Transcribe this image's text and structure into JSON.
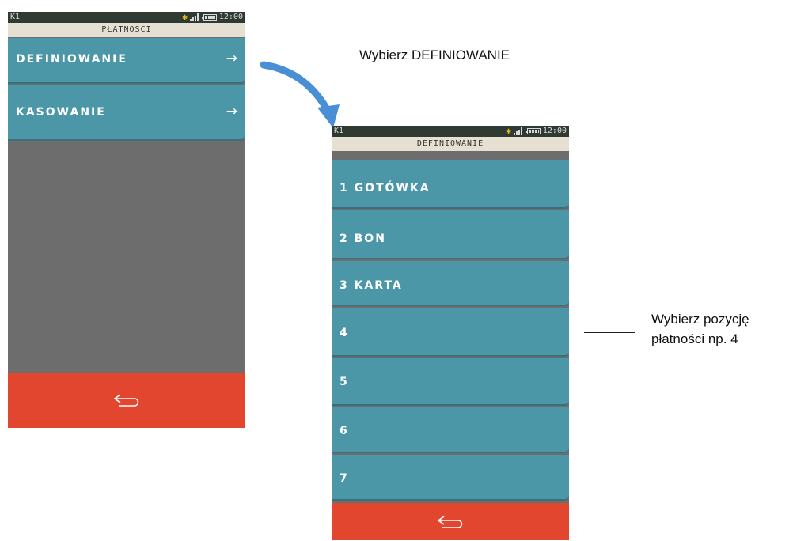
{
  "screen1": {
    "status": {
      "carrier": "K1",
      "time": "12:00"
    },
    "title": "PŁATNOŚCI",
    "items": [
      {
        "label": "DEFINIOWANIE",
        "arrow": "→"
      },
      {
        "label": "KASOWANIE",
        "arrow": "→"
      }
    ],
    "back_icon": "back-arrow-icon"
  },
  "screen2": {
    "status": {
      "carrier": "K1",
      "time": "12:00"
    },
    "title": "DEFINIOWANIE",
    "items": [
      {
        "label": "1  GOTÓWKA"
      },
      {
        "label": "2  BON"
      },
      {
        "label": "3  KARTA"
      },
      {
        "label": "4"
      },
      {
        "label": "5"
      },
      {
        "label": "6"
      },
      {
        "label": "7"
      }
    ],
    "back_icon": "back-arrow-icon"
  },
  "annotations": {
    "select_definiowanie": "Wybierz DEFINIOWANIE",
    "select_position_line1": "Wybierz pozycję",
    "select_position_line2": "płatności np. 4"
  },
  "colors": {
    "menu_item": "#4b97a8",
    "back_bar": "#e2462e",
    "screen_bg": "#6d6d6d",
    "title_bar": "#e6e0d2",
    "status_bar": "#2f3a32",
    "flow_arrow": "#4a8fd6"
  }
}
